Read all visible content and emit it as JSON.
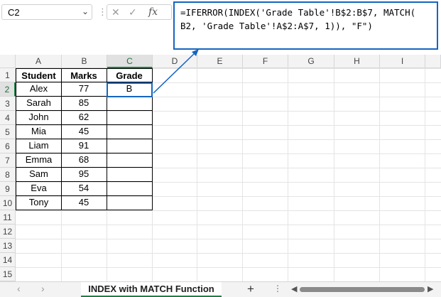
{
  "name_box": {
    "value": "C2"
  },
  "formula_bar": {
    "cancel_icon": "✕",
    "confirm_icon": "✓",
    "fx_label": "fx",
    "formula": "=IFERROR(INDEX('Grade Table'!B$2:B$7, MATCH(\nB2, 'Grade Table'!A$2:A$7, 1)), \"F\")"
  },
  "columns": [
    "A",
    "B",
    "C",
    "D",
    "E",
    "F",
    "G",
    "H",
    "I"
  ],
  "rows": [
    "1",
    "2",
    "3",
    "4",
    "5",
    "6",
    "7",
    "8",
    "9",
    "10",
    "11",
    "12",
    "13",
    "14",
    "15"
  ],
  "table": {
    "headers": {
      "student": "Student",
      "marks": "Marks",
      "grade": "Grade"
    },
    "records": [
      {
        "student": "Alex",
        "marks": "77",
        "grade": "B"
      },
      {
        "student": "Sarah",
        "marks": "85",
        "grade": ""
      },
      {
        "student": "John",
        "marks": "62",
        "grade": ""
      },
      {
        "student": "Mia",
        "marks": "45",
        "grade": ""
      },
      {
        "student": "Liam",
        "marks": "91",
        "grade": ""
      },
      {
        "student": "Emma",
        "marks": "68",
        "grade": ""
      },
      {
        "student": "Sam",
        "marks": "95",
        "grade": ""
      },
      {
        "student": "Eva",
        "marks": "54",
        "grade": ""
      },
      {
        "student": "Tony",
        "marks": "45",
        "grade": ""
      }
    ]
  },
  "sheet_tabs": [
    {
      "label": "INDEX with MATCH Function",
      "active": true
    }
  ],
  "colors": {
    "accent_blue": "#1565c0",
    "selection_green": "#1e7e45"
  }
}
